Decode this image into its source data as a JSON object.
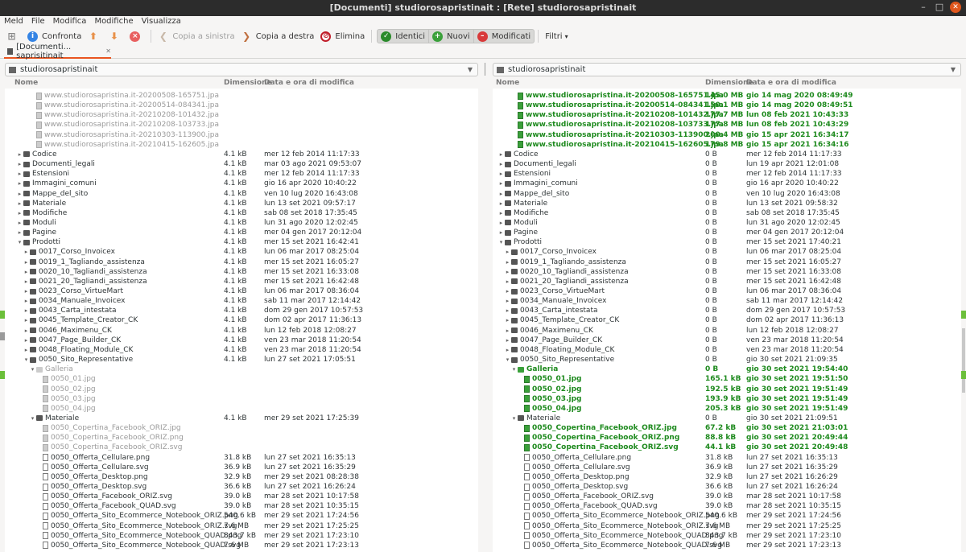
{
  "window": {
    "title": "[Documenti] studiorosapristinait : [Rete] studiorosapristinait"
  },
  "menu": [
    "Meld",
    "File",
    "Modifica",
    "Modifiche",
    "Visualizza"
  ],
  "toolbar": {
    "compare": "Confronta",
    "copy_left": "Copia a sinistra",
    "copy_right": "Copia a destra",
    "delete": "Elimina",
    "identical": "Identici",
    "new": "Nuovi",
    "modified": "Modificati",
    "filters": "Filtri"
  },
  "tab": {
    "label": "[Documenti... saprisitinait"
  },
  "columns": {
    "name": "Nome",
    "size": "Dimensione",
    "date": "Data e ora di modifica"
  },
  "left": {
    "location": "studiorosapristinait",
    "rows": [
      {
        "i": 3,
        "t": "f",
        "s": "removed",
        "n": "www.studiorosapristina.it-20200508-165751.jpa",
        "z": "",
        "d": ""
      },
      {
        "i": 3,
        "t": "f",
        "s": "removed",
        "n": "www.studiorosapristina.it-20200514-084341.jpa",
        "z": "",
        "d": ""
      },
      {
        "i": 3,
        "t": "f",
        "s": "removed",
        "n": "www.studiorosapristina.it-20210208-101432.jpa",
        "z": "",
        "d": ""
      },
      {
        "i": 3,
        "t": "f",
        "s": "removed",
        "n": "www.studiorosapristina.it-20210208-103733.jpa",
        "z": "",
        "d": ""
      },
      {
        "i": 3,
        "t": "f",
        "s": "removed",
        "n": "www.studiorosapristina.it-20210303-113900.jpa",
        "z": "",
        "d": ""
      },
      {
        "i": 3,
        "t": "f",
        "s": "removed",
        "n": "www.studiorosapristina.it-20210415-162605.jpa",
        "z": "",
        "d": ""
      },
      {
        "i": 1,
        "t": "d",
        "e": "c",
        "n": "Codice",
        "z": "4.1 kB",
        "d": "mer 12 feb 2014 11:17:33"
      },
      {
        "i": 1,
        "t": "d",
        "e": "c",
        "n": "Documenti_legali",
        "z": "4.1 kB",
        "d": "mar 03 ago 2021 09:53:07"
      },
      {
        "i": 1,
        "t": "d",
        "e": "c",
        "n": "Estensioni",
        "z": "4.1 kB",
        "d": "mer 12 feb 2014 11:17:33"
      },
      {
        "i": 1,
        "t": "d",
        "e": "c",
        "n": "Immagini_comuni",
        "z": "4.1 kB",
        "d": "gio 16 apr 2020 10:40:22"
      },
      {
        "i": 1,
        "t": "d",
        "e": "c",
        "n": "Mappe_del_sito",
        "z": "4.1 kB",
        "d": "ven 10 lug 2020 16:43:08"
      },
      {
        "i": 1,
        "t": "d",
        "e": "c",
        "n": "Materiale",
        "z": "4.1 kB",
        "d": "lun 13 set 2021 09:57:17"
      },
      {
        "i": 1,
        "t": "d",
        "e": "c",
        "n": "Modifiche",
        "z": "4.1 kB",
        "d": "sab 08 set 2018 17:35:45"
      },
      {
        "i": 1,
        "t": "d",
        "e": "c",
        "n": "Moduli",
        "z": "4.1 kB",
        "d": "lun 31 ago 2020 12:02:45"
      },
      {
        "i": 1,
        "t": "d",
        "e": "c",
        "n": "Pagine",
        "z": "4.1 kB",
        "d": "mer 04 gen 2017 20:12:04"
      },
      {
        "i": 1,
        "t": "d",
        "e": "o",
        "n": "Prodotti",
        "z": "4.1 kB",
        "d": "mer 15 set 2021 16:42:41"
      },
      {
        "i": 2,
        "t": "d",
        "e": "c",
        "n": "0017_Corso_Invoicex",
        "z": "4.1 kB",
        "d": "lun 06 mar 2017 08:25:04"
      },
      {
        "i": 2,
        "t": "d",
        "e": "c",
        "n": "0019_1_Tagliando_assistenza",
        "z": "4.1 kB",
        "d": "mer 15 set 2021 16:05:27"
      },
      {
        "i": 2,
        "t": "d",
        "e": "c",
        "n": "0020_10_Tagliandi_assistenza",
        "z": "4.1 kB",
        "d": "mer 15 set 2021 16:33:08"
      },
      {
        "i": 2,
        "t": "d",
        "e": "c",
        "n": "0021_20_Tagliandi_assistenza",
        "z": "4.1 kB",
        "d": "mer 15 set 2021 16:42:48"
      },
      {
        "i": 2,
        "t": "d",
        "e": "c",
        "n": "0023_Corso_VirtueMart",
        "z": "4.1 kB",
        "d": "lun 06 mar 2017 08:36:04"
      },
      {
        "i": 2,
        "t": "d",
        "e": "c",
        "n": "0034_Manuale_Invoicex",
        "z": "4.1 kB",
        "d": "sab 11 mar 2017 12:14:42"
      },
      {
        "i": 2,
        "t": "d",
        "e": "c",
        "n": "0043_Carta_intestata",
        "z": "4.1 kB",
        "d": "dom 29 gen 2017 10:57:53"
      },
      {
        "i": 2,
        "t": "d",
        "e": "c",
        "n": "0045_Template_Creator_CK",
        "z": "4.1 kB",
        "d": "dom 02 apr 2017 11:36:13"
      },
      {
        "i": 2,
        "t": "d",
        "e": "c",
        "n": "0046_Maximenu_CK",
        "z": "4.1 kB",
        "d": "lun 12 feb 2018 12:08:27"
      },
      {
        "i": 2,
        "t": "d",
        "e": "c",
        "n": "0047_Page_Builder_CK",
        "z": "4.1 kB",
        "d": "ven 23 mar 2018 11:20:54"
      },
      {
        "i": 2,
        "t": "d",
        "e": "c",
        "n": "0048_Floating_Module_CK",
        "z": "4.1 kB",
        "d": "ven 23 mar 2018 11:20:54"
      },
      {
        "i": 2,
        "t": "d",
        "e": "o",
        "n": "0050_Sito_Representative",
        "z": "4.1 kB",
        "d": "lun 27 set 2021 17:05:51"
      },
      {
        "i": 3,
        "t": "d",
        "e": "o",
        "s": "removed",
        "n": "Galleria",
        "z": "",
        "d": ""
      },
      {
        "i": 4,
        "t": "f",
        "s": "removed",
        "n": "0050_01.jpg",
        "z": "",
        "d": ""
      },
      {
        "i": 4,
        "t": "f",
        "s": "removed",
        "n": "0050_02.jpg",
        "z": "",
        "d": ""
      },
      {
        "i": 4,
        "t": "f",
        "s": "removed",
        "n": "0050_03.jpg",
        "z": "",
        "d": ""
      },
      {
        "i": 4,
        "t": "f",
        "s": "removed",
        "n": "0050_04.jpg",
        "z": "",
        "d": ""
      },
      {
        "i": 3,
        "t": "d",
        "e": "o",
        "n": "Materiale",
        "z": "4.1 kB",
        "d": "mer 29 set 2021 17:25:39"
      },
      {
        "i": 4,
        "t": "f",
        "s": "removed",
        "n": "0050_Copertina_Facebook_ORIZ.jpg",
        "z": "",
        "d": ""
      },
      {
        "i": 4,
        "t": "f",
        "s": "removed",
        "n": "0050_Copertina_Facebook_ORIZ.png",
        "z": "",
        "d": ""
      },
      {
        "i": 4,
        "t": "f",
        "s": "removed",
        "n": "0050_Copertina_Facebook_ORIZ.svg",
        "z": "",
        "d": ""
      },
      {
        "i": 4,
        "t": "f",
        "n": "0050_Offerta_Cellulare.png",
        "z": "31.8 kB",
        "d": "lun 27 set 2021 16:35:13"
      },
      {
        "i": 4,
        "t": "f",
        "n": "0050_Offerta_Cellulare.svg",
        "z": "36.9 kB",
        "d": "lun 27 set 2021 16:35:29"
      },
      {
        "i": 4,
        "t": "f",
        "n": "0050_Offerta_Desktop.png",
        "z": "32.9 kB",
        "d": "mer 29 set 2021 08:28:38"
      },
      {
        "i": 4,
        "t": "f",
        "n": "0050_Offerta_Desktop.svg",
        "z": "36.6 kB",
        "d": "lun 27 set 2021 16:26:24"
      },
      {
        "i": 4,
        "t": "f",
        "n": "0050_Offerta_Facebook_ORIZ.svg",
        "z": "39.0 kB",
        "d": "mar 28 set 2021 10:17:58"
      },
      {
        "i": 4,
        "t": "f",
        "n": "0050_Offerta_Facebook_QUAD.svg",
        "z": "39.0 kB",
        "d": "mar 28 set 2021 10:35:15"
      },
      {
        "i": 4,
        "t": "f",
        "n": "0050_Offerta_Sito_Ecommerce_Notebook_ORIZ.png",
        "z": "540.6 kB",
        "d": "mer 29 set 2021 17:24:56"
      },
      {
        "i": 4,
        "t": "f",
        "n": "0050_Offerta_Sito_Ecommerce_Notebook_ORIZ.svg",
        "z": "7.6 MB",
        "d": "mer 29 set 2021 17:25:25"
      },
      {
        "i": 4,
        "t": "f",
        "n": "0050_Offerta_Sito_Ecommerce_Notebook_QUAD.png",
        "z": "843.7 kB",
        "d": "mer 29 set 2021 17:23:10"
      },
      {
        "i": 4,
        "t": "f",
        "n": "0050_Offerta_Sito_Ecommerce_Notebook_QUAD.svg",
        "z": "7.6 MB",
        "d": "mer 29 set 2021 17:23:13"
      }
    ]
  },
  "right": {
    "location": "studiorosapristinait",
    "rows": [
      {
        "i": 3,
        "t": "f",
        "s": "new",
        "n": "www.studiorosapristina.it-20200508-165751.jpa",
        "z": "145.0 MB",
        "d": "gio 14 mag 2020 08:49:49"
      },
      {
        "i": 3,
        "t": "f",
        "s": "new",
        "n": "www.studiorosapristina.it-20200514-084341.jpa",
        "z": "150.1 MB",
        "d": "gio 14 mag 2020 08:49:51"
      },
      {
        "i": 3,
        "t": "f",
        "s": "new",
        "n": "www.studiorosapristina.it-20210208-101432.jpa",
        "z": "177.7 MB",
        "d": "lun 08 feb 2021 10:43:33"
      },
      {
        "i": 3,
        "t": "f",
        "s": "new",
        "n": "www.studiorosapristina.it-20210208-103733.jpa",
        "z": "177.8 MB",
        "d": "lun 08 feb 2021 10:43:29"
      },
      {
        "i": 3,
        "t": "f",
        "s": "new",
        "n": "www.studiorosapristina.it-20210303-113900.jpa",
        "z": "200.4 MB",
        "d": "gio 15 apr 2021 16:34:17"
      },
      {
        "i": 3,
        "t": "f",
        "s": "new",
        "n": "www.studiorosapristina.it-20210415-162605.jpa",
        "z": "179.8 MB",
        "d": "gio 15 apr 2021 16:34:16"
      },
      {
        "i": 1,
        "t": "d",
        "e": "c",
        "n": "Codice",
        "z": "0 B",
        "d": "mer 12 feb 2014 11:17:33"
      },
      {
        "i": 1,
        "t": "d",
        "e": "c",
        "n": "Documenti_legali",
        "z": "0 B",
        "d": "lun 19 apr 2021 12:01:08"
      },
      {
        "i": 1,
        "t": "d",
        "e": "c",
        "n": "Estensioni",
        "z": "0 B",
        "d": "mer 12 feb 2014 11:17:33"
      },
      {
        "i": 1,
        "t": "d",
        "e": "c",
        "n": "Immagini_comuni",
        "z": "0 B",
        "d": "gio 16 apr 2020 10:40:22"
      },
      {
        "i": 1,
        "t": "d",
        "e": "c",
        "n": "Mappe_del_sito",
        "z": "0 B",
        "d": "ven 10 lug 2020 16:43:08"
      },
      {
        "i": 1,
        "t": "d",
        "e": "c",
        "n": "Materiale",
        "z": "0 B",
        "d": "lun 13 set 2021 09:58:32"
      },
      {
        "i": 1,
        "t": "d",
        "e": "c",
        "n": "Modifiche",
        "z": "0 B",
        "d": "sab 08 set 2018 17:35:45"
      },
      {
        "i": 1,
        "t": "d",
        "e": "c",
        "n": "Moduli",
        "z": "0 B",
        "d": "lun 31 ago 2020 12:02:45"
      },
      {
        "i": 1,
        "t": "d",
        "e": "c",
        "n": "Pagine",
        "z": "0 B",
        "d": "mer 04 gen 2017 20:12:04"
      },
      {
        "i": 1,
        "t": "d",
        "e": "o",
        "n": "Prodotti",
        "z": "0 B",
        "d": "mer 15 set 2021 17:40:21"
      },
      {
        "i": 2,
        "t": "d",
        "e": "c",
        "n": "0017_Corso_Invoicex",
        "z": "0 B",
        "d": "lun 06 mar 2017 08:25:04"
      },
      {
        "i": 2,
        "t": "d",
        "e": "c",
        "n": "0019_1_Tagliando_assistenza",
        "z": "0 B",
        "d": "mer 15 set 2021 16:05:27"
      },
      {
        "i": 2,
        "t": "d",
        "e": "c",
        "n": "0020_10_Tagliandi_assistenza",
        "z": "0 B",
        "d": "mer 15 set 2021 16:33:08"
      },
      {
        "i": 2,
        "t": "d",
        "e": "c",
        "n": "0021_20_Tagliandi_assistenza",
        "z": "0 B",
        "d": "mer 15 set 2021 16:42:48"
      },
      {
        "i": 2,
        "t": "d",
        "e": "c",
        "n": "0023_Corso_VirtueMart",
        "z": "0 B",
        "d": "lun 06 mar 2017 08:36:04"
      },
      {
        "i": 2,
        "t": "d",
        "e": "c",
        "n": "0034_Manuale_Invoicex",
        "z": "0 B",
        "d": "sab 11 mar 2017 12:14:42"
      },
      {
        "i": 2,
        "t": "d",
        "e": "c",
        "n": "0043_Carta_intestata",
        "z": "0 B",
        "d": "dom 29 gen 2017 10:57:53"
      },
      {
        "i": 2,
        "t": "d",
        "e": "c",
        "n": "0045_Template_Creator_CK",
        "z": "0 B",
        "d": "dom 02 apr 2017 11:36:13"
      },
      {
        "i": 2,
        "t": "d",
        "e": "c",
        "n": "0046_Maximenu_CK",
        "z": "0 B",
        "d": "lun 12 feb 2018 12:08:27"
      },
      {
        "i": 2,
        "t": "d",
        "e": "c",
        "n": "0047_Page_Builder_CK",
        "z": "0 B",
        "d": "ven 23 mar 2018 11:20:54"
      },
      {
        "i": 2,
        "t": "d",
        "e": "c",
        "n": "0048_Floating_Module_CK",
        "z": "0 B",
        "d": "ven 23 mar 2018 11:20:54"
      },
      {
        "i": 2,
        "t": "d",
        "e": "o",
        "n": "0050_Sito_Representative",
        "z": "0 B",
        "d": "gio 30 set 2021 21:09:35"
      },
      {
        "i": 3,
        "t": "d",
        "e": "o",
        "s": "new",
        "n": "Galleria",
        "z": "0 B",
        "d": "gio 30 set 2021 19:54:40"
      },
      {
        "i": 4,
        "t": "f",
        "s": "new",
        "n": "0050_01.jpg",
        "z": "165.1 kB",
        "d": "gio 30 set 2021 19:51:50"
      },
      {
        "i": 4,
        "t": "f",
        "s": "new",
        "n": "0050_02.jpg",
        "z": "192.5 kB",
        "d": "gio 30 set 2021 19:51:49"
      },
      {
        "i": 4,
        "t": "f",
        "s": "new",
        "n": "0050_03.jpg",
        "z": "193.9 kB",
        "d": "gio 30 set 2021 19:51:49"
      },
      {
        "i": 4,
        "t": "f",
        "s": "new",
        "n": "0050_04.jpg",
        "z": "205.3 kB",
        "d": "gio 30 set 2021 19:51:49"
      },
      {
        "i": 3,
        "t": "d",
        "e": "o",
        "n": "Materiale",
        "z": "0 B",
        "d": "gio 30 set 2021 21:09:51"
      },
      {
        "i": 4,
        "t": "f",
        "s": "new",
        "n": "0050_Copertina_Facebook_ORIZ.jpg",
        "z": "67.2 kB",
        "d": "gio 30 set 2021 21:03:01"
      },
      {
        "i": 4,
        "t": "f",
        "s": "new",
        "n": "0050_Copertina_Facebook_ORIZ.png",
        "z": "88.8 kB",
        "d": "gio 30 set 2021 20:49:44"
      },
      {
        "i": 4,
        "t": "f",
        "s": "new",
        "n": "0050_Copertina_Facebook_ORIZ.svg",
        "z": "44.1 kB",
        "d": "gio 30 set 2021 20:49:48"
      },
      {
        "i": 4,
        "t": "f",
        "n": "0050_Offerta_Cellulare.png",
        "z": "31.8 kB",
        "d": "lun 27 set 2021 16:35:13"
      },
      {
        "i": 4,
        "t": "f",
        "n": "0050_Offerta_Cellulare.svg",
        "z": "36.9 kB",
        "d": "lun 27 set 2021 16:35:29"
      },
      {
        "i": 4,
        "t": "f",
        "n": "0050_Offerta_Desktop.png",
        "z": "32.9 kB",
        "d": "lun 27 set 2021 16:26:29"
      },
      {
        "i": 4,
        "t": "f",
        "n": "0050_Offerta_Desktop.svg",
        "z": "36.6 kB",
        "d": "lun 27 set 2021 16:26:24"
      },
      {
        "i": 4,
        "t": "f",
        "n": "0050_Offerta_Facebook_ORIZ.svg",
        "z": "39.0 kB",
        "d": "mar 28 set 2021 10:17:58"
      },
      {
        "i": 4,
        "t": "f",
        "n": "0050_Offerta_Facebook_QUAD.svg",
        "z": "39.0 kB",
        "d": "mar 28 set 2021 10:35:15"
      },
      {
        "i": 4,
        "t": "f",
        "n": "0050_Offerta_Sito_Ecommerce_Notebook_ORIZ.png",
        "z": "540.6 kB",
        "d": "mer 29 set 2021 17:24:56"
      },
      {
        "i": 4,
        "t": "f",
        "n": "0050_Offerta_Sito_Ecommerce_Notebook_ORIZ.svg",
        "z": "7.6 MB",
        "d": "mer 29 set 2021 17:25:25"
      },
      {
        "i": 4,
        "t": "f",
        "n": "0050_Offerta_Sito_Ecommerce_Notebook_QUAD.png",
        "z": "843.7 kB",
        "d": "mer 29 set 2021 17:23:10"
      },
      {
        "i": 4,
        "t": "f",
        "n": "0050_Offerta_Sito_Ecommerce_Notebook_QUAD.svg",
        "z": "7.6 MB",
        "d": "mer 29 set 2021 17:23:13"
      }
    ]
  }
}
